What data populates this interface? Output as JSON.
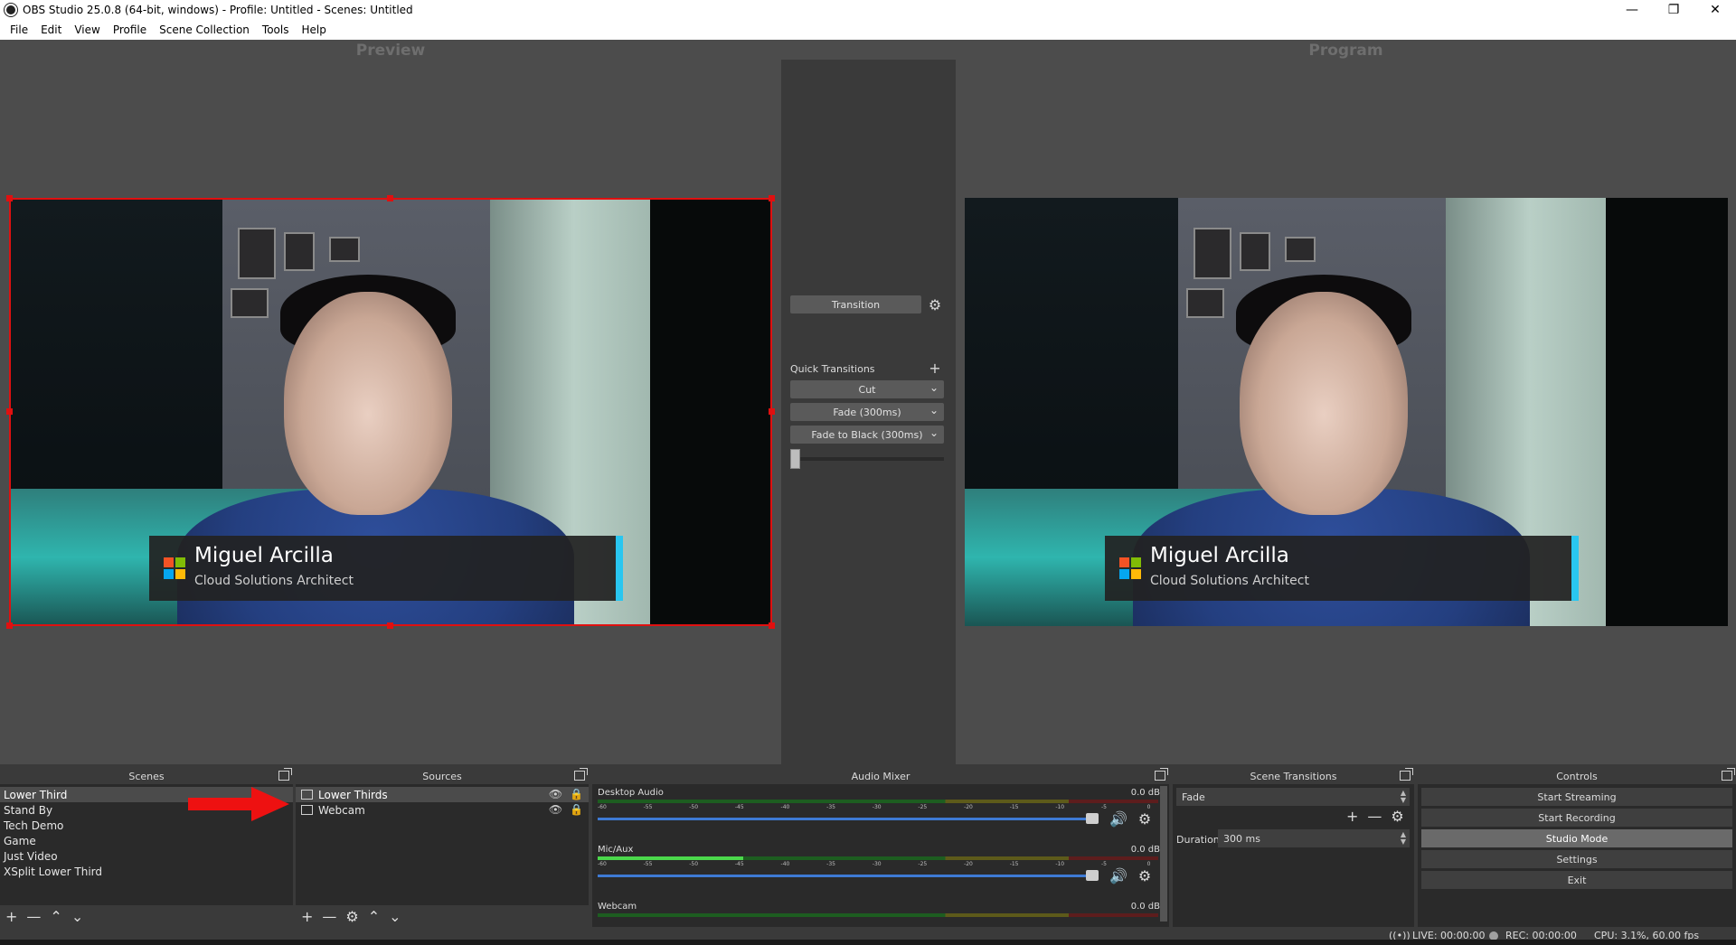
{
  "window": {
    "title": "OBS Studio 25.0.8 (64-bit, windows) - Profile: Untitled - Scenes: Untitled",
    "minimize": "—",
    "maximize": "❐",
    "close": "✕"
  },
  "menu": [
    "File",
    "Edit",
    "View",
    "Profile",
    "Scene Collection",
    "Tools",
    "Help"
  ],
  "preview": {
    "label": "Preview",
    "overlay_name": "Miguel Arcilla",
    "overlay_role": "Cloud Solutions Architect",
    "selection_color": "#e01010"
  },
  "program": {
    "label": "Program",
    "overlay_name": "Miguel Arcilla",
    "overlay_role": "Cloud Solutions Architect"
  },
  "transition_panel": {
    "transition_button": "Transition",
    "quick_transitions_label": "Quick Transitions",
    "quick_items": [
      "Cut",
      "Fade (300ms)",
      "Fade to Black (300ms)"
    ],
    "tbar_position": 0
  },
  "scenes": {
    "header": "Scenes",
    "items": [
      "Lower Third",
      "Stand By",
      "Tech Demo",
      "Game",
      "Just Video",
      "XSplit Lower Third"
    ],
    "selected_index": 0
  },
  "sources": {
    "header": "Sources",
    "items": [
      {
        "label": "Lower Thirds",
        "icon": "browser-source-icon"
      },
      {
        "label": "Webcam",
        "icon": "camera-source-icon"
      }
    ]
  },
  "audio_mixer": {
    "header": "Audio Mixer",
    "tracks": [
      {
        "name": "Desktop Audio",
        "db": "0.0 dB",
        "level": 0.0,
        "volume": 1.0
      },
      {
        "name": "Mic/Aux",
        "db": "0.0 dB",
        "level": 0.26,
        "volume": 1.0
      },
      {
        "name": "Webcam",
        "db": "0.0 dB",
        "level": 0.0,
        "volume": 1.0
      }
    ],
    "ticks": [
      "-60",
      "-55",
      "-50",
      "-45",
      "-40",
      "-35",
      "-30",
      "-25",
      "-20",
      "-15",
      "-10",
      "-5",
      "0"
    ]
  },
  "scene_transitions": {
    "header": "Scene Transitions",
    "selected": "Fade",
    "duration_label": "Duration",
    "duration_value": "300 ms"
  },
  "controls": {
    "header": "Controls",
    "buttons": [
      "Start Streaming",
      "Start Recording",
      "Studio Mode",
      "Settings",
      "Exit"
    ],
    "active_index": 2
  },
  "status": {
    "live": "LIVE: 00:00:00",
    "rec": "REC: 00:00:00",
    "cpu": "CPU: 3.1%, 60.00 fps"
  },
  "colors": {
    "accent_bar": "#29c6f0",
    "ms_red": "#f35325",
    "ms_green": "#81bc06",
    "ms_blue": "#05a6f0",
    "ms_yellow": "#ffba08",
    "arrow": "#ee1111"
  }
}
